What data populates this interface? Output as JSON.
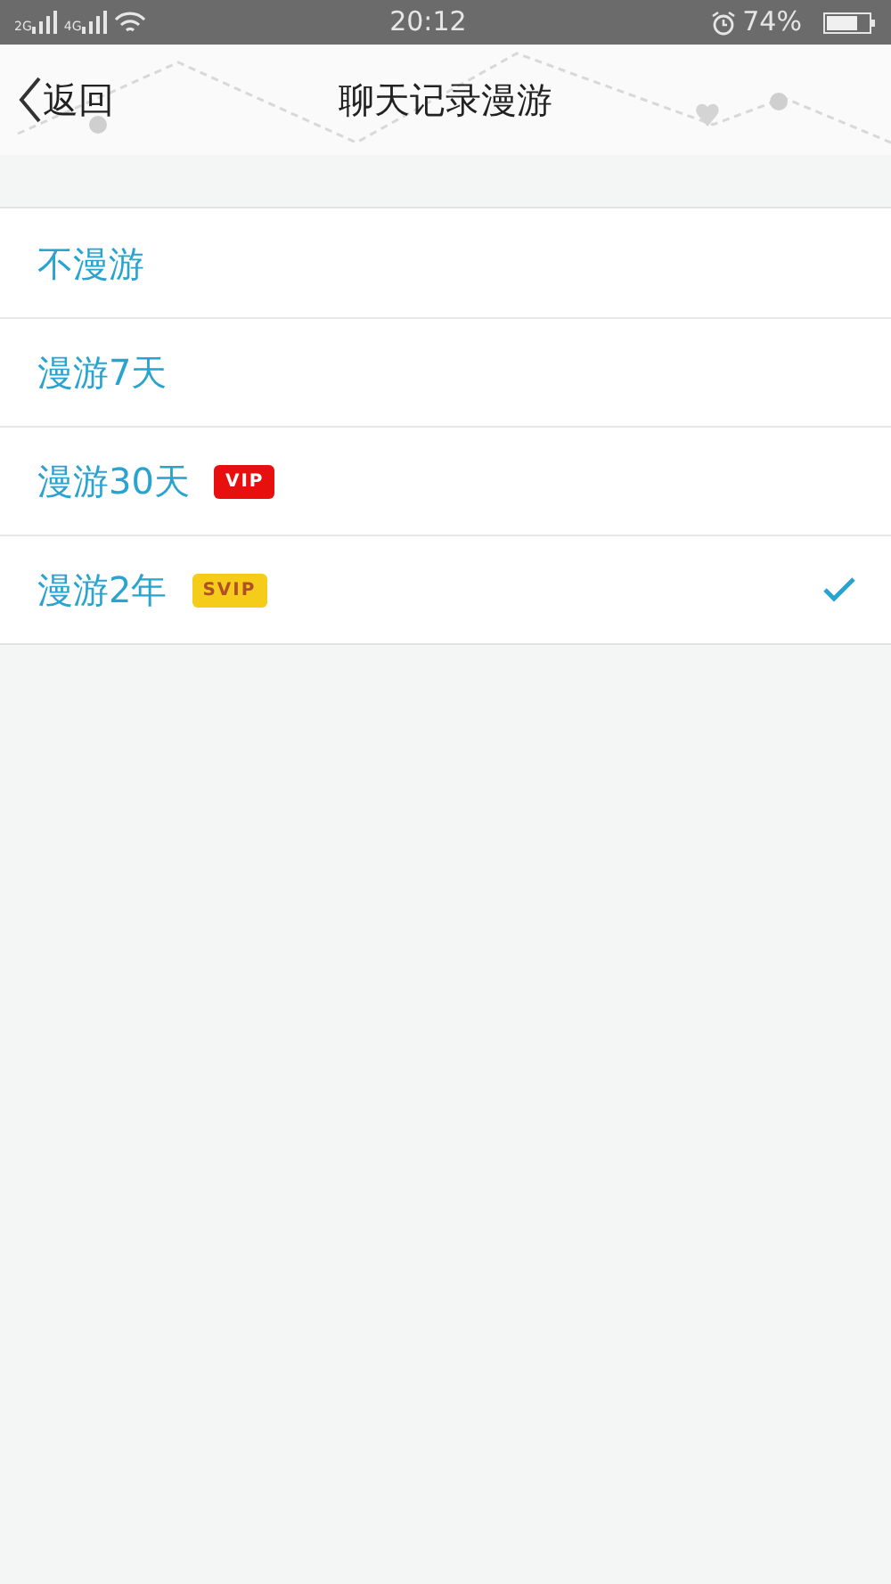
{
  "status_bar": {
    "signal_labels": [
      "2G",
      "4G"
    ],
    "time": "20:12",
    "battery": "74%"
  },
  "header": {
    "back": "返回",
    "title": "聊天记录漫游"
  },
  "options": [
    {
      "label": "不漫游",
      "selected": false
    },
    {
      "label": "漫游7天",
      "selected": false
    },
    {
      "label": "漫游30天",
      "badge": {
        "text": "VIP",
        "kind": "vip"
      },
      "selected": false
    },
    {
      "label": "漫游2年",
      "badge": {
        "text": "SVIP",
        "kind": "svip"
      },
      "selected": true
    }
  ]
}
